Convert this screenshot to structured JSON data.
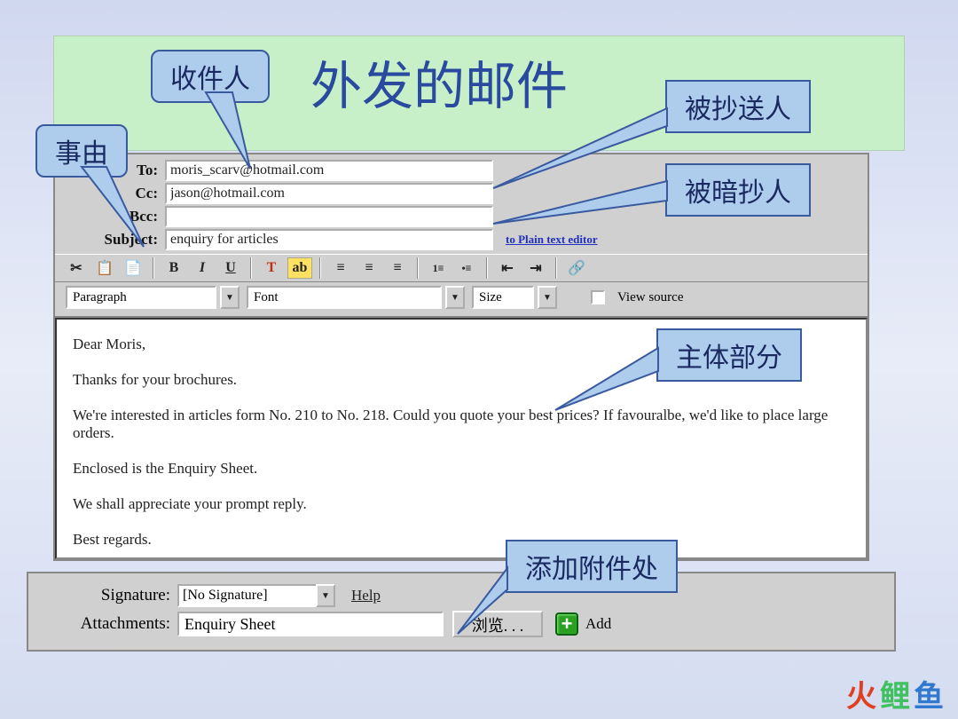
{
  "title": "外发的邮件",
  "callouts": {
    "recipient": "收件人",
    "reason": "事由",
    "cc": "被抄送人",
    "bcc": "被暗抄人",
    "body": "主体部分",
    "attach": "添加附件处"
  },
  "fields": {
    "to_label": "To:",
    "to_value": "moris_scarv@hotmail.com",
    "cc_label": "Cc:",
    "cc_value": "jason@hotmail.com",
    "bcc_label": "Bcc:",
    "bcc_value": "",
    "subject_label": "Subject:",
    "subject_value": "enquiry for articles",
    "plain_text": "to Plain text editor"
  },
  "toolbar": {
    "bold": "B",
    "italic": "I",
    "underline": "U"
  },
  "selectors": {
    "paragraph": "Paragraph",
    "font": "Font",
    "size": "Size",
    "view_source": "View source"
  },
  "body": "Dear Moris,\n\nThanks for your brochures.\n\nWe're interested in articles form No. 210 to No. 218. Could you quote your best prices? If favouralbe, we'd like to place large orders.\n\nEnclosed is the Enquiry Sheet.\n\nWe shall appreciate your prompt reply.\n\nBest regards.",
  "bottom": {
    "signature_label": "Signature:",
    "signature_value": "[No Signature]",
    "help": "Help",
    "attachments_label": "Attachments:",
    "attachments_value": "Enquiry Sheet",
    "browse": "浏览. . .",
    "add": "Add"
  },
  "watermark": {
    "c1": "火",
    "c2": "鲤",
    "c3": "鱼"
  }
}
